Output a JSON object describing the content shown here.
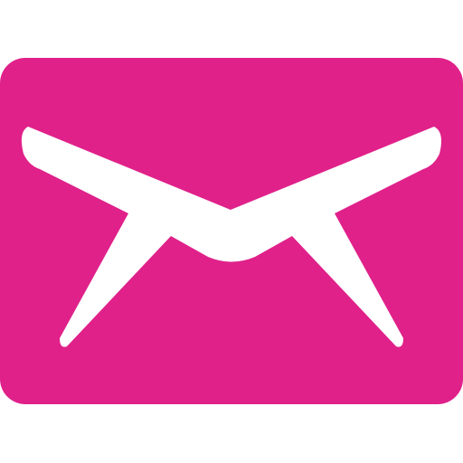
{
  "icon": {
    "name": "mail-icon",
    "shape": "envelope",
    "background_color": "#e0218a",
    "foreground_color": "#ffffff"
  }
}
